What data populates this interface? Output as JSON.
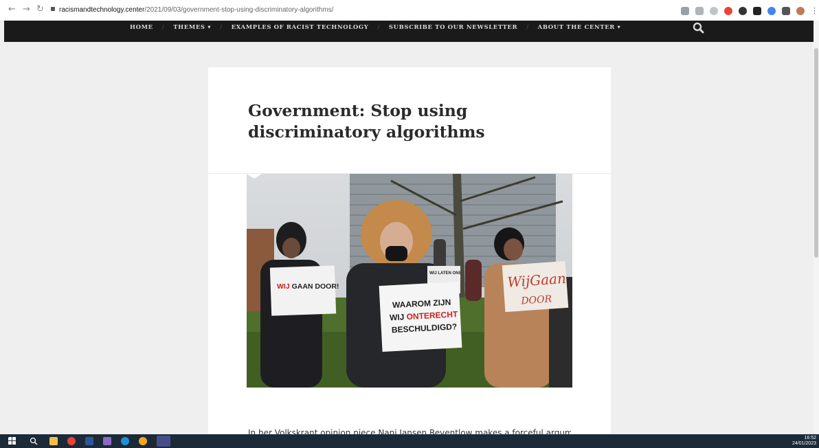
{
  "browser": {
    "url_host": "racismandtechnology.center",
    "url_path": "/2021/09/03/government-stop-using-discriminatory-algorithms/"
  },
  "site_nav": {
    "items": [
      {
        "label": "HOME"
      },
      {
        "label": "THEMES ▾"
      },
      {
        "label": "EXAMPLES OF RACIST TECHNOLOGY"
      },
      {
        "label": "SUBSCRIBE TO OUR NEWSLETTER"
      },
      {
        "label": "ABOUT THE CENTER ▾"
      }
    ],
    "separator": "/"
  },
  "article": {
    "title": "Government: Stop using discriminatory algorithms",
    "body_preview": "In her Volkskrant opinion piece Nani Jansen Reventlow makes a forceful argument for the",
    "photo_signs": {
      "sign1_a": "WIJ",
      "sign1_b": " GAAN DOOR!",
      "sign2_l1": "WAAROM ZIJN",
      "sign2_l2a": "WIJ ",
      "sign2_l2b": "ONTERECHT",
      "sign2_l3": "BESCHULDIGD?",
      "sign3_l1": "WijGaan",
      "sign3_l2": "DOOR",
      "sign4": "WIJ LATEN ONS"
    }
  },
  "taskbar": {
    "time": "16:52",
    "date": "24/01/2023"
  },
  "colors": {
    "nav_bg": "#1a1a1a",
    "page_bg": "#efefef",
    "title_color": "#2b2b2b",
    "taskbar_bg": "#1c2a38"
  }
}
